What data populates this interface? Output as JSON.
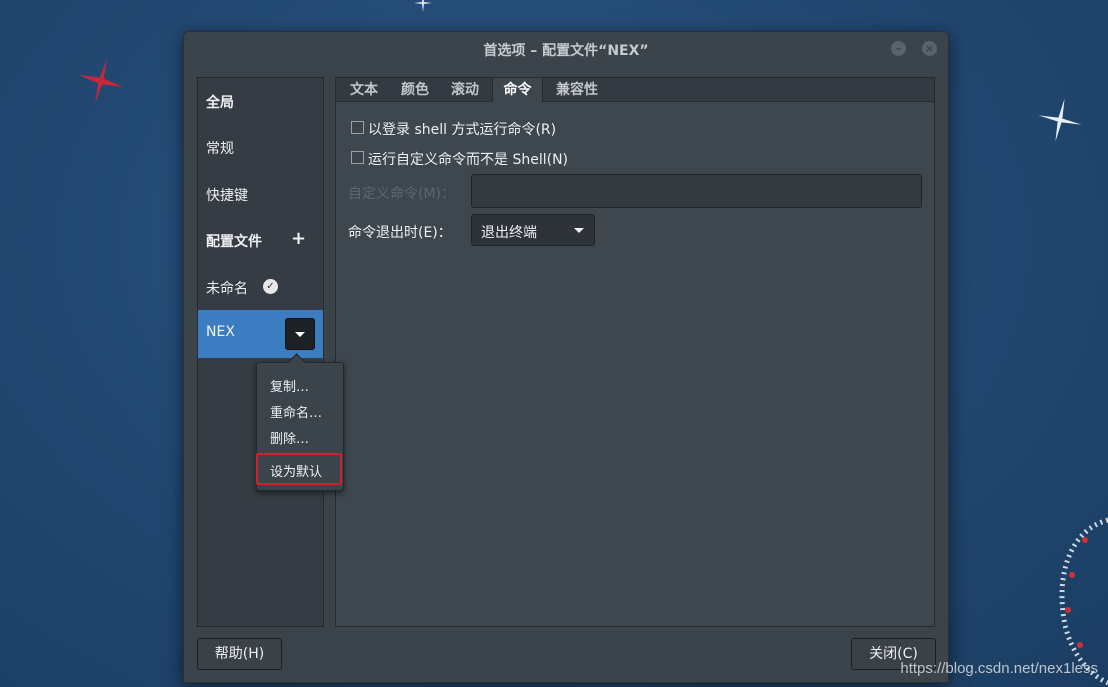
{
  "window": {
    "title": "首选项 – 配置文件“NEX”",
    "minimize_icon": "minimize-icon",
    "close_icon": "close-icon"
  },
  "sidebar": {
    "global_header": "全局",
    "general": "常规",
    "shortcuts": "快捷键",
    "profiles_header": "配置文件",
    "add_icon": "plus-icon",
    "profiles": [
      {
        "label": "未命名",
        "default_icon": "check-circle-icon"
      },
      {
        "label": "NEX",
        "selected": true,
        "menu_icon": "dropdown-arrow-icon"
      }
    ]
  },
  "profile_menu": {
    "items": [
      "复制…",
      "重命名…",
      "删除…",
      "设为默认"
    ],
    "highlighted": "设为默认"
  },
  "tabs": [
    "文本",
    "颜色",
    "滚动",
    "命令",
    "兼容性"
  ],
  "active_tab": "命令",
  "command_tab": {
    "login_shell_label": "以登录 shell 方式运行命令(R)",
    "login_shell_checked": false,
    "custom_command_label": "运行自定义命令而不是 Shell(N)",
    "custom_command_checked": false,
    "custom_command_field_label": "自定义命令(M)：",
    "custom_command_value": "",
    "on_exit_label": "命令退出时(E)：",
    "on_exit_value": "退出终端"
  },
  "footer": {
    "help_button": "帮助(H)",
    "close_button": "关闭(C)"
  },
  "watermark": "https://blog.csdn.net/nex1less",
  "colors": {
    "accent": "#3c7cc0",
    "highlight_border": "#d0202a",
    "window_bg": "#3b434b"
  }
}
